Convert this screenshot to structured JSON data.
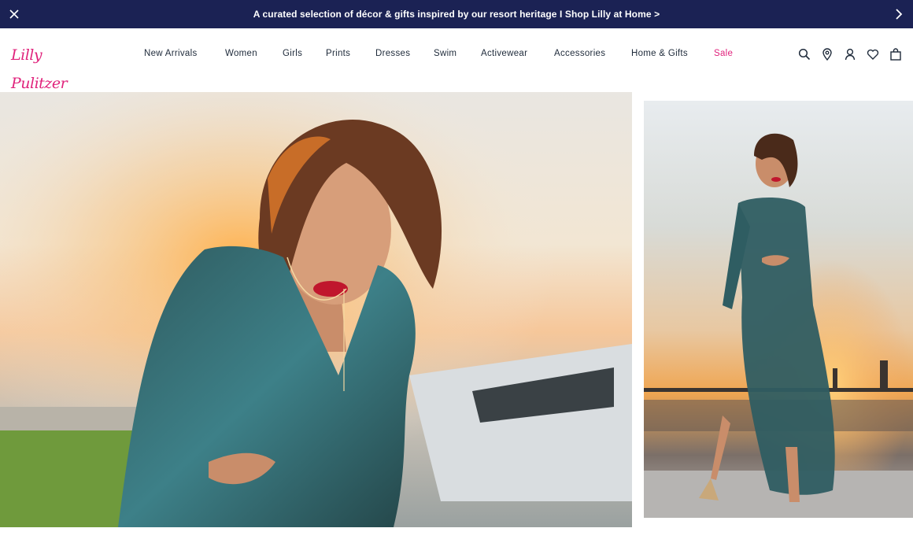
{
  "promo": {
    "text": "A curated selection of décor & gifts inspired by our resort heritage I Shop Lilly at Home >"
  },
  "brand": {
    "logo_text": "Lilly Pulitzer",
    "accent_color": "#e0237c",
    "banner_color": "#1b2254"
  },
  "nav": {
    "items": [
      {
        "label": "New Arrivals"
      },
      {
        "label": "Women"
      },
      {
        "label": "Girls"
      },
      {
        "label": "Prints"
      },
      {
        "label": "Dresses"
      },
      {
        "label": "Swim"
      },
      {
        "label": "Activewear"
      },
      {
        "label": "Accessories"
      },
      {
        "label": "Home & Gifts"
      },
      {
        "label": "Sale"
      }
    ]
  },
  "header_icons": [
    "search-icon",
    "location-pin-icon",
    "account-icon",
    "wishlist-heart-icon",
    "shopping-bag-icon"
  ],
  "hero": {
    "left_image": "model-closeup-teal-metallic-dress-sunset",
    "right_image": "model-full-length-teal-metallic-dress-dock"
  }
}
